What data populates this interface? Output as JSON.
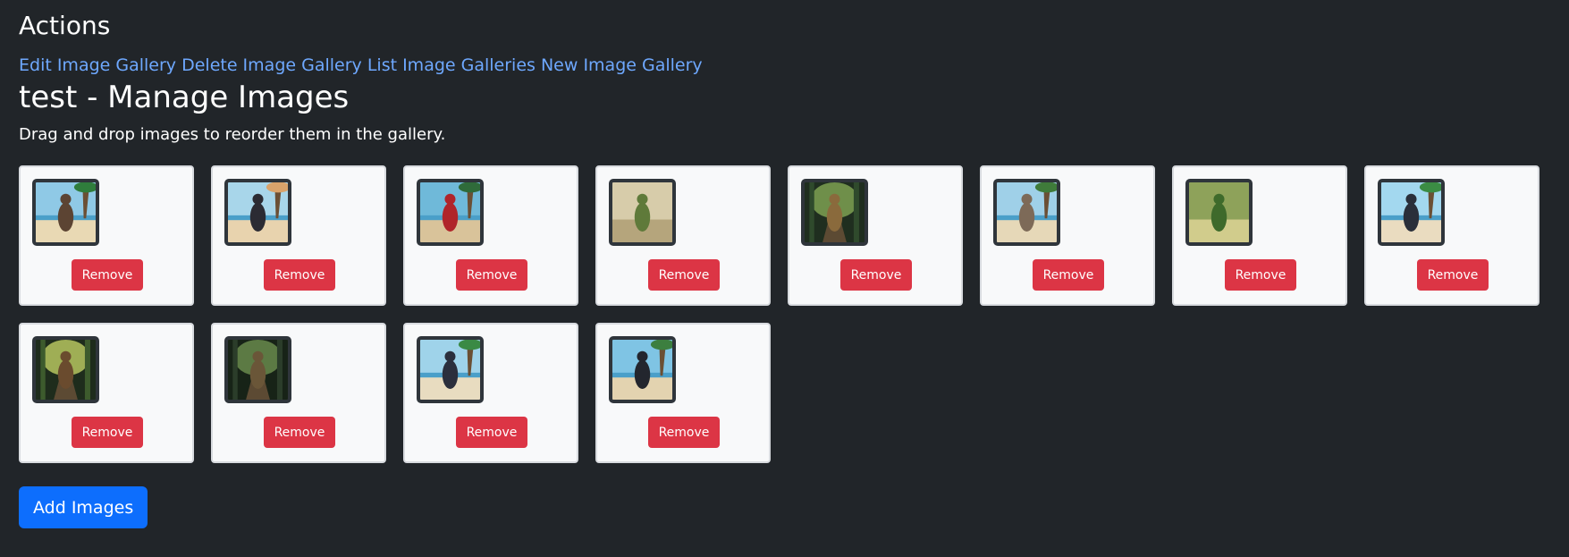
{
  "actions": {
    "heading": "Actions",
    "links": [
      {
        "label": "Edit Image Gallery"
      },
      {
        "label": "Delete Image Gallery"
      },
      {
        "label": "List Image Galleries"
      },
      {
        "label": "New Image Gallery"
      }
    ]
  },
  "gallery": {
    "title": "test - Manage Images",
    "instructions": "Drag and drop images to reorder them in the gallery.",
    "add_button_label": "Add Images",
    "remove_label": "Remove"
  },
  "images": [
    {
      "scene": "beach",
      "colors": [
        "#8fc9e6",
        "#e9d9b4",
        "#5c4433",
        "#2f7d3c"
      ]
    },
    {
      "scene": "beach",
      "colors": [
        "#a8d6ea",
        "#e8d3ae",
        "#2b2b33",
        "#d9a36b"
      ]
    },
    {
      "scene": "beach",
      "colors": [
        "#6fb9d9",
        "#d9c39a",
        "#b0242a",
        "#2f6b3a"
      ]
    },
    {
      "scene": "field",
      "colors": [
        "#d7ccaa",
        "#b5a57c",
        "#5f7a3a",
        "#7d5c3a"
      ]
    },
    {
      "scene": "jungle",
      "colors": [
        "#2f4a2c",
        "#6f8f4a",
        "#8a6a3c",
        "#1f2e1f"
      ]
    },
    {
      "scene": "beach",
      "colors": [
        "#9fd0e8",
        "#e6d8b8",
        "#7d6a58",
        "#3f7b3a"
      ]
    },
    {
      "scene": "field",
      "colors": [
        "#8ea25a",
        "#d1cc8c",
        "#3e6a2b",
        "#b8463a"
      ]
    },
    {
      "scene": "beach",
      "colors": [
        "#a3d8ef",
        "#eadcc0",
        "#2a2f3a",
        "#3b8c44"
      ]
    },
    {
      "scene": "jungle",
      "colors": [
        "#3d5b2d",
        "#9fae55",
        "#6a4b2e",
        "#1e2c1c"
      ]
    },
    {
      "scene": "jungle",
      "colors": [
        "#2b3d2a",
        "#5c7a44",
        "#6a5638",
        "#172317"
      ]
    },
    {
      "scene": "beach",
      "colors": [
        "#9fd3ea",
        "#e8dcc0",
        "#2b2f3d",
        "#3a8a45"
      ]
    },
    {
      "scene": "beach",
      "colors": [
        "#7fc4e4",
        "#e3d3b0",
        "#23262e",
        "#3c7f3f"
      ]
    }
  ],
  "colors": {
    "background": "#212529",
    "link": "#6ea8fe",
    "remove_button": "#dc3545",
    "add_button": "#0d6efd"
  }
}
